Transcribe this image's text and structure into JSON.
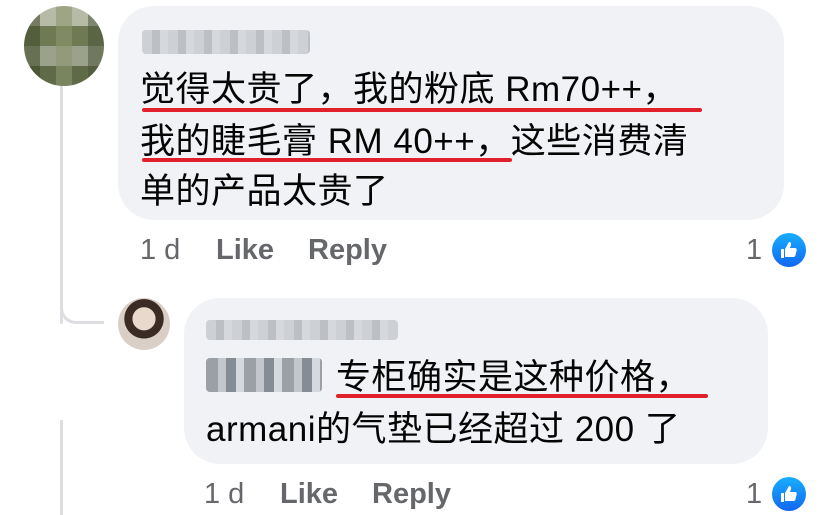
{
  "comments": [
    {
      "lines": [
        "觉得太贵了，我的粉底 Rm70++，",
        "我的睫毛膏 RM 40++，这些消费清",
        "单的产品太贵了"
      ],
      "time": "1 d",
      "like_label": "Like",
      "reply_label": "Reply",
      "reaction_count": "1"
    }
  ],
  "reply": {
    "lines": [
      "专柜确实是这种价格，",
      "armani的气垫已经超过 200 了"
    ],
    "time": "1 d",
    "like_label": "Like",
    "reply_label": "Reply",
    "reaction_count": "1"
  },
  "colors": {
    "bubble": "#f0f2f5",
    "underline": "#e0202a",
    "meta_text": "#65676b",
    "like_blue": "#1877f2"
  },
  "icons": {
    "reaction": "thumbs-up-icon"
  }
}
